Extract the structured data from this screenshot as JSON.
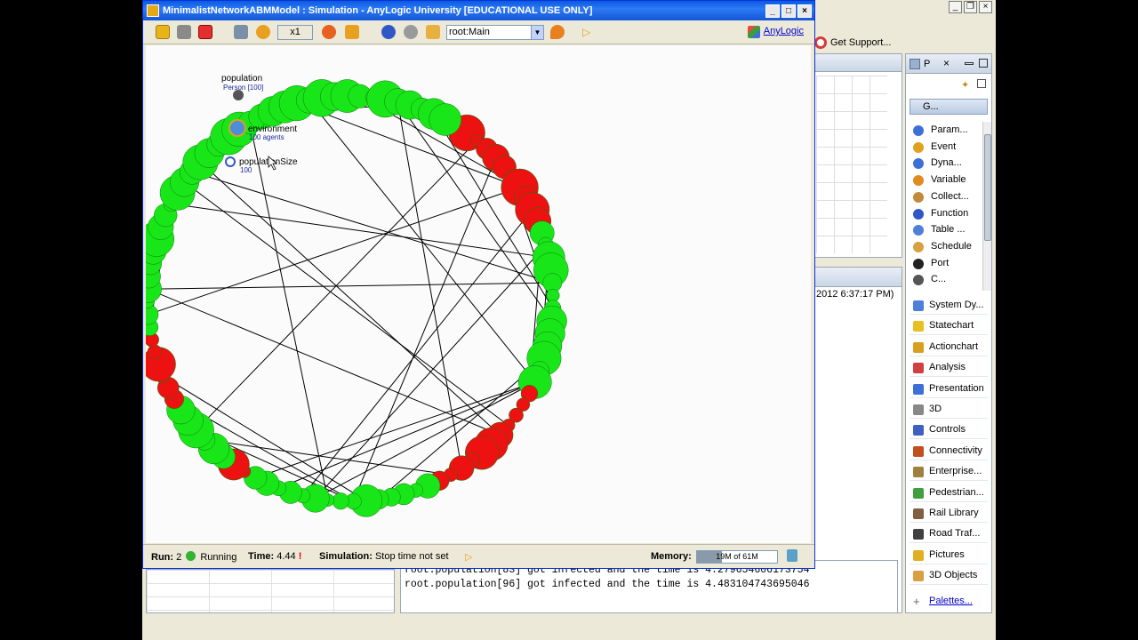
{
  "sim_window": {
    "title": "MinimalistNetworkABMModel : Simulation - AnyLogic University  [EDUCATIONAL USE ONLY]",
    "speed": "x1",
    "view_selector": "root:Main",
    "brand_link": "AnyLogic"
  },
  "canvas": {
    "population_label": "population",
    "population_sub": "Person [100]",
    "environment_label": "environment",
    "environment_sub": "100 agents",
    "population_size_label": "populationSize",
    "population_size_value": "100"
  },
  "statusbar": {
    "run_label": "Run:",
    "run_value": "2",
    "run_state": "Running",
    "time_label": "Time:",
    "time_value": "4.44",
    "sim_label": "Simulation:",
    "sim_value": "Stop time not set",
    "memory_label": "Memory:",
    "memory_value": "19M of 61M",
    "memory_fraction": 0.31
  },
  "ide": {
    "get_support": "Get Support...",
    "properties_date": "2012 6:37:17 PM)",
    "console_lines": [
      "root.population[83] got infected and the time is 4.279654606173754",
      "root.population[96] got infected and the time is 4.483104743695046"
    ]
  },
  "palette": {
    "tab_label": "P",
    "general_label": "G...",
    "general_items": [
      {
        "label": "Param...",
        "icon": "parameter-icon",
        "color": "#3d6fd8"
      },
      {
        "label": "Event",
        "icon": "event-icon",
        "color": "#e0a020"
      },
      {
        "label": "Dyna...",
        "icon": "dynamic-variable-icon",
        "color": "#3d6fd8"
      },
      {
        "label": "Variable",
        "icon": "variable-icon",
        "color": "#e08a20"
      },
      {
        "label": "Collect...",
        "icon": "collection-icon",
        "color": "#c28a3a"
      },
      {
        "label": "Function",
        "icon": "function-icon",
        "color": "#2f58c4"
      },
      {
        "label": "Table ...",
        "icon": "table-function-icon",
        "color": "#4f7fd8"
      },
      {
        "label": "Schedule",
        "icon": "schedule-icon",
        "color": "#d8a040"
      },
      {
        "label": "Port",
        "icon": "port-icon",
        "color": "#222222"
      },
      {
        "label": "C...",
        "icon": "connector-icon",
        "color": "#555555"
      }
    ],
    "sections": [
      {
        "label": "System Dy...",
        "icon": "system-dynamics-icon",
        "color": "#4f7fd8"
      },
      {
        "label": "Statechart",
        "icon": "statechart-icon",
        "color": "#e8c020"
      },
      {
        "label": "Actionchart",
        "icon": "actionchart-icon",
        "color": "#d8a020"
      },
      {
        "label": "Analysis",
        "icon": "analysis-icon",
        "color": "#d04040"
      },
      {
        "label": "Presentation",
        "icon": "presentation-icon",
        "color": "#3d6fd8"
      },
      {
        "label": "3D",
        "icon": "3d-icon",
        "color": "#888888"
      },
      {
        "label": "Controls",
        "icon": "controls-icon",
        "color": "#4060c0"
      },
      {
        "label": "Connectivity",
        "icon": "connectivity-icon",
        "color": "#c05020"
      },
      {
        "label": "Enterprise...",
        "icon": "enterprise-library-icon",
        "color": "#a08040"
      },
      {
        "label": "Pedestrian...",
        "icon": "pedestrian-library-icon",
        "color": "#40a040"
      },
      {
        "label": "Rail Library",
        "icon": "rail-library-icon",
        "color": "#806040"
      },
      {
        "label": "Road Traf...",
        "icon": "road-traffic-icon",
        "color": "#404040"
      },
      {
        "label": "Pictures",
        "icon": "pictures-icon",
        "color": "#e0b020"
      },
      {
        "label": "3D Objects",
        "icon": "3d-objects-icon",
        "color": "#d8a040"
      }
    ],
    "palettes_link": "Palettes..."
  },
  "colors": {
    "healthy": "#19e619",
    "infected": "#ee1111",
    "edge": "#000000"
  }
}
